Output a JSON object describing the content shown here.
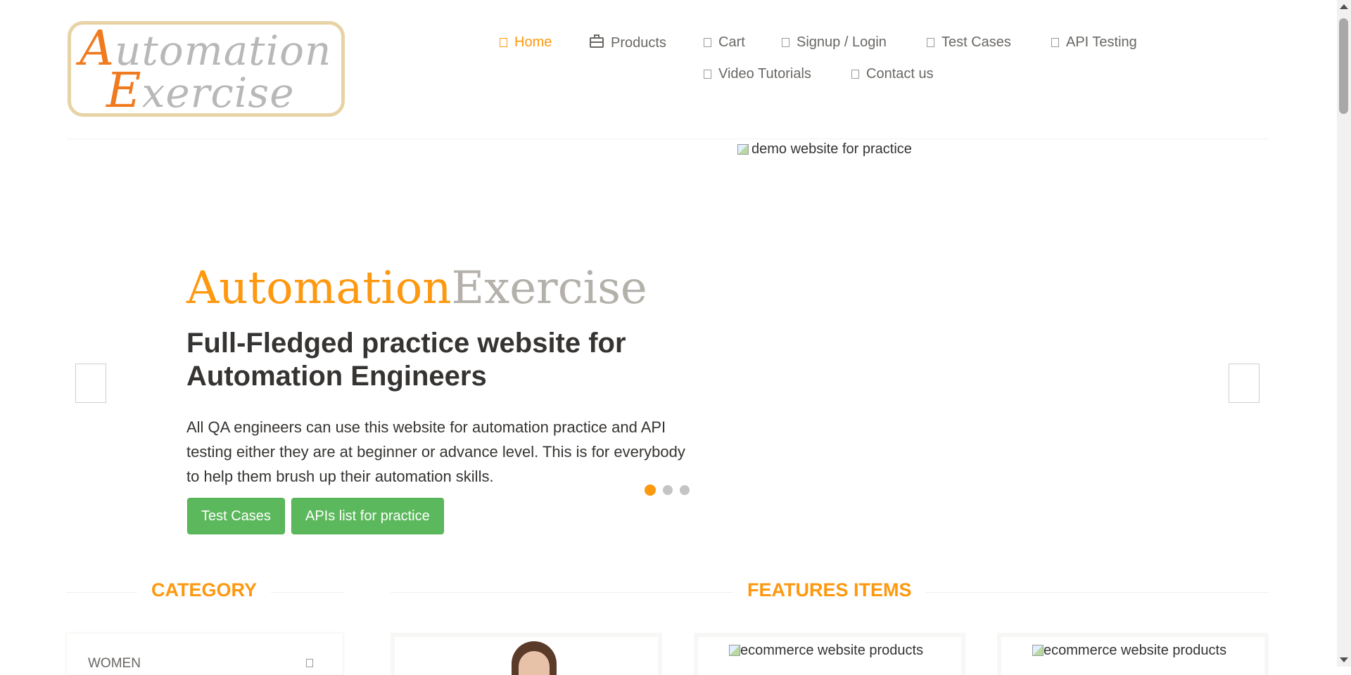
{
  "header": {
    "logo_text_line1": "Automation",
    "logo_text_line2": "Exercise",
    "nav": [
      {
        "label": "Home",
        "icon": "home-icon",
        "active": true
      },
      {
        "label": "Products",
        "icon": "briefcase-icon",
        "active": false
      },
      {
        "label": "Cart",
        "icon": "cart-icon",
        "active": false
      },
      {
        "label": "Signup / Login",
        "icon": "lock-icon",
        "active": false
      },
      {
        "label": "Test Cases",
        "icon": "list-icon",
        "active": false
      },
      {
        "label": "API Testing",
        "icon": "list-icon",
        "active": false
      },
      {
        "label": "Video Tutorials",
        "icon": "youtube-icon",
        "active": false
      },
      {
        "label": "Contact us",
        "icon": "envelope-icon",
        "active": false
      }
    ]
  },
  "slider": {
    "image_alt": "demo website for practice",
    "brand_part1": "Automation",
    "brand_part2": "Exercise",
    "heading": "Full-Fledged practice website for Automation Engineers",
    "text": "All QA engineers can use this website for automation practice and API testing either they are at beginner or advance level. This is for everybody to help them brush up their automation skills.",
    "btn_test_cases": "Test Cases",
    "btn_apis": "APIs list for practice",
    "active_slide": 1,
    "slide_count": 3
  },
  "category": {
    "title": "CATEGORY",
    "items": [
      "WOMEN"
    ]
  },
  "features": {
    "title": "FEATURES ITEMS",
    "product_image_alt": "ecommerce website products"
  },
  "colors": {
    "accent": "#fe980f",
    "button_green": "#5cb85c",
    "text": "#696763",
    "heading": "#363432"
  }
}
